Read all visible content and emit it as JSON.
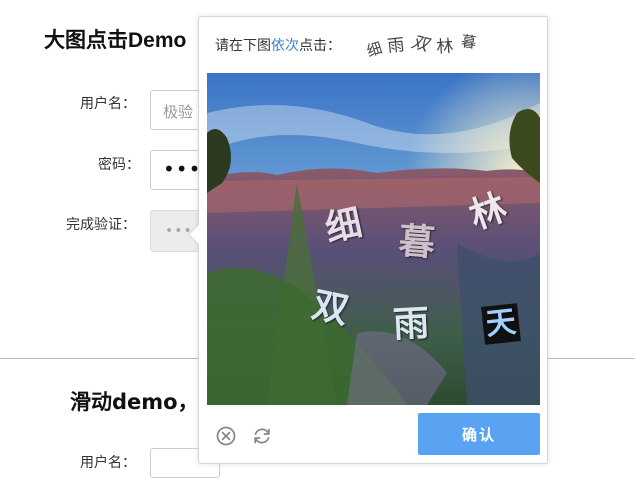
{
  "page": {
    "title": "大图点击Demo",
    "username_label": "用户名：",
    "username_value": "极验",
    "password_label": "密码：",
    "password_value": "••••••",
    "verify_label": "完成验证：",
    "verify_placeholder": "•••",
    "section2_title": "滑动demo，",
    "section2_username_label": "用户名："
  },
  "captcha": {
    "prompt_prefix": "请在下图",
    "prompt_highlight": "依次",
    "prompt_suffix": "点击：",
    "target_chars": [
      "细",
      "雨",
      "双",
      "林",
      "暮"
    ],
    "image_chars": [
      "细",
      "暮",
      "林",
      "双",
      "雨",
      "天"
    ],
    "confirm_label": "确认",
    "highlight_color": "#3a84d0",
    "button_color": "#5aa3f2"
  },
  "icons": {
    "close": "close-circle-icon",
    "refresh": "refresh-icon"
  }
}
